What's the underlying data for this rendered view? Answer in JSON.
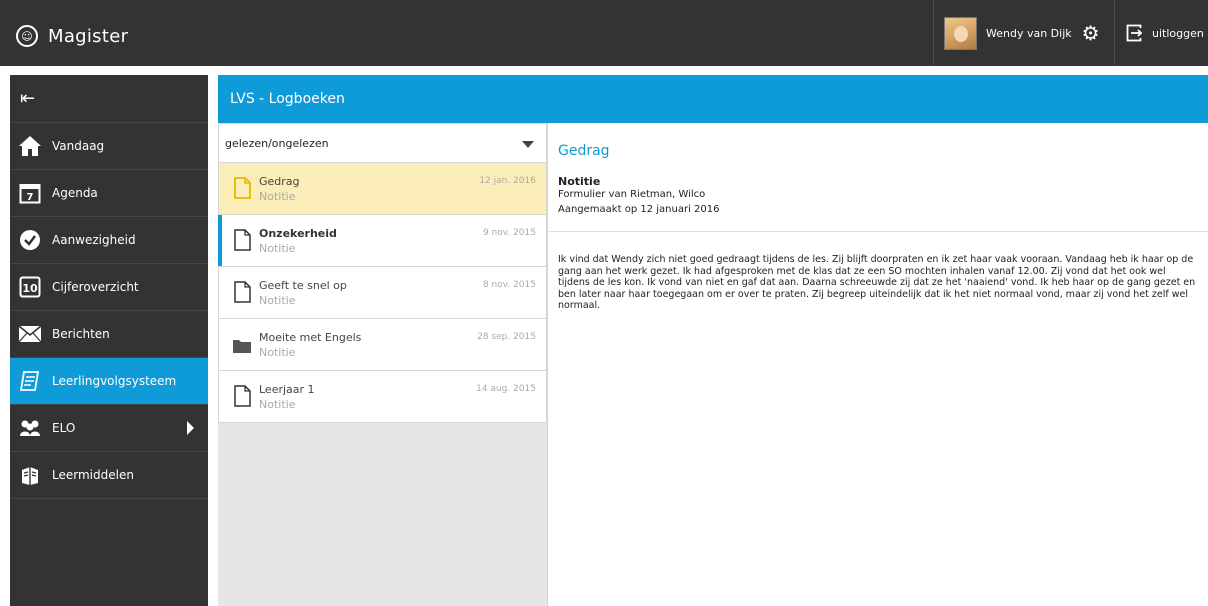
{
  "app": {
    "name": "Magister",
    "logo_icon": "magister-logo-icon"
  },
  "topbar": {
    "user_name": "Wendy van Dijk",
    "settings_icon": "gear-icon",
    "logout_label": "uitloggen",
    "logout_icon": "logout-icon"
  },
  "sidebar": {
    "toggle_icon": "menu-collapse-icon",
    "items": [
      {
        "label": "Vandaag",
        "icon": "home-icon"
      },
      {
        "label": "Agenda",
        "icon": "calendar-icon"
      },
      {
        "label": "Aanwezigheid",
        "icon": "check-circle-icon"
      },
      {
        "label": "Cijferoverzicht",
        "icon": "grade-icon"
      },
      {
        "label": "Berichten",
        "icon": "envelope-icon"
      },
      {
        "label": "Leerlingvolgsysteem",
        "icon": "notebook-icon",
        "active": true
      },
      {
        "label": "ELO",
        "icon": "group-icon",
        "has_submenu": true
      },
      {
        "label": "Leermiddelen",
        "icon": "books-icon"
      }
    ]
  },
  "main": {
    "title": "LVS - Logboeken"
  },
  "list": {
    "filter_value": "gelezen/ongelezen",
    "items": [
      {
        "title": "Gedrag",
        "subtitle": "Notitie",
        "date": "12 jan. 2016"
      },
      {
        "title": "Onzekerheid",
        "subtitle": "Notitie",
        "date": "9 nov. 2015"
      },
      {
        "title": "Geeft te snel op",
        "subtitle": "Notitie",
        "date": "8 nov. 2015"
      },
      {
        "title": "Moeite met Engels",
        "subtitle": "Notitie",
        "date": "28 sep. 2015"
      },
      {
        "title": "Leerjaar 1",
        "subtitle": "Notitie",
        "date": "14 aug. 2015"
      }
    ]
  },
  "detail": {
    "title": "Gedrag",
    "type": "Notitie",
    "form": "Formulier van Rietman, Wilco",
    "created": "Aangemaakt op 12 januari 2016",
    "body": "Ik vind dat Wendy zich niet goed gedraagt tijdens de les. Zij blijft doorpraten en ik zet haar vaak vooraan. Vandaag heb ik haar op de gang aan het werk gezet. Ik had afgesproken met de klas dat ze een SO mochten inhalen vanaf 12.00. Zij vond dat het ook wel tijdens de les kon. Ik vond van niet en gaf dat aan. Daarna schreeuwde zij dat ze het 'naaiend' vond. Ik heb haar op de gang gezet en ben later naar haar toegegaan om er over te praten. Zij begreep uiteindelijk dat ik het niet normaal vond, maar zij vond het zelf wel normaal."
  },
  "colors": {
    "accent": "#0f9ad8",
    "dark": "#333333",
    "selected_row": "#fbedb7"
  }
}
